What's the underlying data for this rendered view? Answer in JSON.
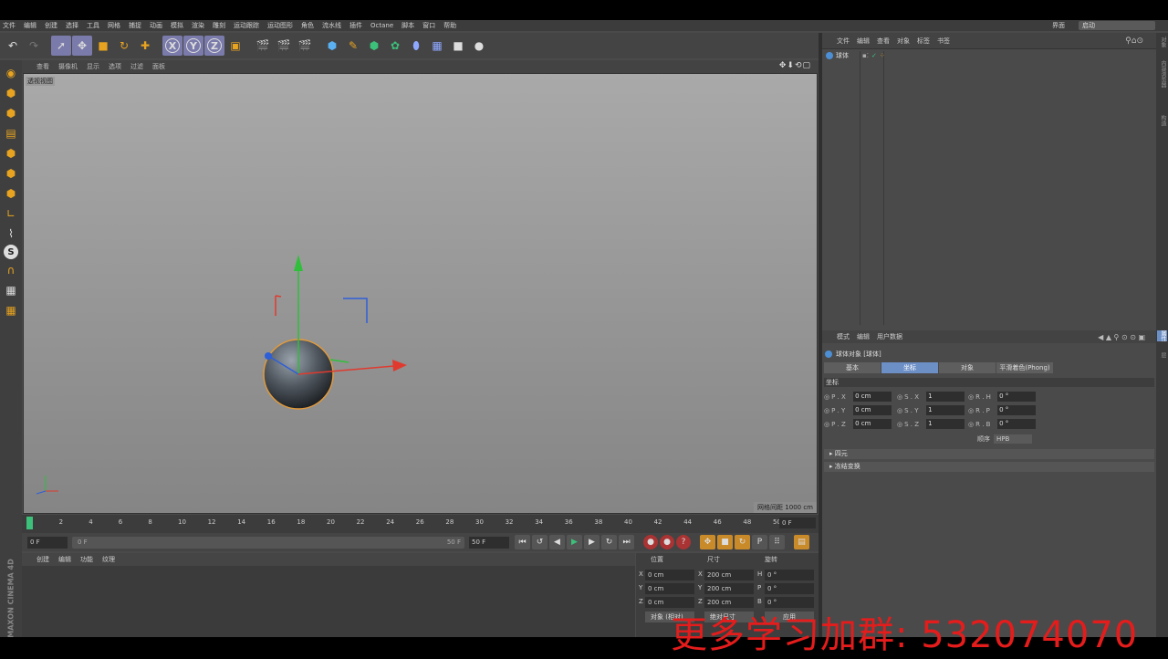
{
  "menubar": {
    "items": [
      "文件",
      "编辑",
      "创建",
      "选择",
      "工具",
      "网格",
      "捕捉",
      "动画",
      "模拟",
      "渲染",
      "雕刻",
      "运动跟踪",
      "运动图形",
      "角色",
      "流水线",
      "插件",
      "Octane",
      "脚本",
      "窗口",
      "帮助"
    ],
    "layout_label": "界面",
    "layout_value": "启动"
  },
  "toolbar": {
    "icons": [
      "undo-icon",
      "redo-icon",
      "select-icon",
      "move-icon",
      "scale-icon",
      "rotate-icon",
      "live-select-icon",
      "x-axis-icon",
      "y-axis-icon",
      "z-axis-icon",
      "coord-system-icon",
      "render-view-icon",
      "render-pv-icon",
      "render-settings-icon",
      "cube-icon",
      "pen-icon",
      "subdivide-icon",
      "array-icon",
      "deformer-icon",
      "floor-icon",
      "camera-icon",
      "light-icon"
    ],
    "axis_labels": [
      "X",
      "Y",
      "Z"
    ]
  },
  "viewport": {
    "menu": [
      "查看",
      "摄像机",
      "显示",
      "选项",
      "过滤",
      "面板"
    ],
    "label": "透视视图",
    "grid_label": "网格间距",
    "grid_value": "1000 cm"
  },
  "timeline": {
    "ticks": [
      "0",
      "2",
      "4",
      "6",
      "8",
      "10",
      "12",
      "14",
      "16",
      "18",
      "20",
      "22",
      "24",
      "26",
      "28",
      "30",
      "32",
      "34",
      "36",
      "38",
      "40",
      "42",
      "44",
      "46",
      "48",
      "50"
    ],
    "current": "0 F"
  },
  "playback": {
    "start": "0 F",
    "slider_start": "0 F",
    "slider_end": "50 F",
    "end": "50 F"
  },
  "materials": {
    "menu": [
      "创建",
      "编辑",
      "功能",
      "纹理"
    ]
  },
  "coordinates": {
    "headers": [
      "位置",
      "尺寸",
      "旋转"
    ],
    "rows": [
      {
        "axis": "X",
        "pos": "0 cm",
        "size_axis": "X",
        "size": "200 cm",
        "rot_axis": "H",
        "rot": "0 °"
      },
      {
        "axis": "Y",
        "pos": "0 cm",
        "size_axis": "Y",
        "size": "200 cm",
        "rot_axis": "P",
        "rot": "0 °"
      },
      {
        "axis": "Z",
        "pos": "0 cm",
        "size_axis": "Z",
        "size": "200 cm",
        "rot_axis": "B",
        "rot": "0 °"
      }
    ],
    "mode_button": "对象 (相对)",
    "size_button": "绝对尺寸",
    "apply_button": "应用"
  },
  "brand": "MAXON CINEMA 4D",
  "objects": {
    "menu": [
      "文件",
      "编辑",
      "查看",
      "对象",
      "标签",
      "书签"
    ],
    "items": [
      {
        "name": "球体"
      }
    ]
  },
  "attributes": {
    "menu": [
      "模式",
      "编辑",
      "用户数据"
    ],
    "title": "球体对象 [球体]",
    "tabs": [
      "基本",
      "坐标",
      "对象",
      "平滑着色(Phong)"
    ],
    "active_tab": "坐标",
    "section": "坐标",
    "params": [
      [
        {
          "label": "P . X",
          "value": "0 cm"
        },
        {
          "label": "S . X",
          "value": "1"
        },
        {
          "label": "R . H",
          "value": "0 °"
        }
      ],
      [
        {
          "label": "P . Y",
          "value": "0 cm"
        },
        {
          "label": "S . Y",
          "value": "1"
        },
        {
          "label": "R . P",
          "value": "0 °"
        }
      ],
      [
        {
          "label": "P . Z",
          "value": "0 cm"
        },
        {
          "label": "S . Z",
          "value": "1"
        },
        {
          "label": "R . B",
          "value": "0 °"
        }
      ]
    ],
    "order_label": "顺序",
    "order_value": "HPB",
    "collapsed": [
      "四元",
      "冻结变换"
    ]
  },
  "right_tabs": [
    "对象",
    "内容浏览器",
    "构造",
    "属性",
    "层"
  ],
  "watermark": "更多学习加群: 532074070",
  "colors": {
    "accent": "#6c8fc6",
    "x_axis": "#e03a2e",
    "y_axis": "#2fbf3a",
    "z_axis": "#2e5fd8",
    "watermark": "#e51c1c"
  }
}
